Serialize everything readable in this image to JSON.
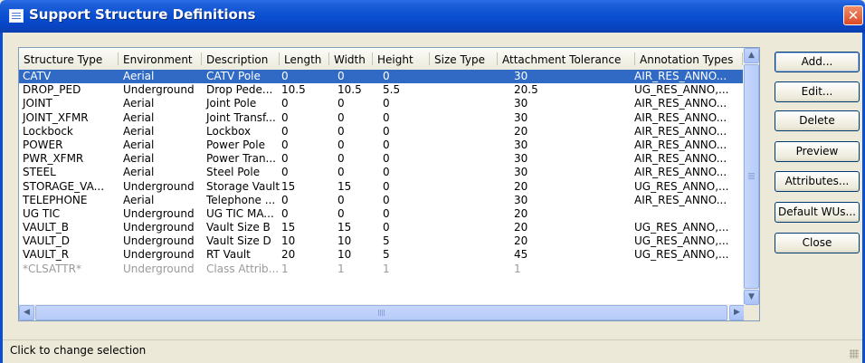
{
  "window": {
    "title": "Support Structure Definitions",
    "close_glyph": "✕",
    "accent": "#0a4fd1",
    "selection_color": "#316ac5"
  },
  "columns": [
    "Structure Type",
    "Environment",
    "Description",
    "Length",
    "Width",
    "Height",
    "Size Type",
    "Attachment Tolerance",
    "Annotation Types"
  ],
  "rows": [
    [
      "CATV",
      "Aerial",
      "CATV Pole",
      "0",
      "0",
      "0",
      "",
      "30",
      "AIR_RES_ANNO..."
    ],
    [
      "DROP_PED",
      "Underground",
      "Drop Pede...",
      "10.5",
      "10.5",
      "5.5",
      "",
      "20.5",
      "UG_RES_ANNO,..."
    ],
    [
      "JOINT",
      "Aerial",
      "Joint Pole",
      "0",
      "0",
      "0",
      "",
      "30",
      "AIR_RES_ANNO..."
    ],
    [
      "JOINT_XFMR",
      "Aerial",
      "Joint Transf...",
      "0",
      "0",
      "0",
      "",
      "30",
      "AIR_RES_ANNO..."
    ],
    [
      "Lockbock",
      "Aerial",
      "Lockbox",
      "0",
      "0",
      "0",
      "",
      "20",
      "AIR_RES_ANNO..."
    ],
    [
      "POWER",
      "Aerial",
      "Power Pole",
      "0",
      "0",
      "0",
      "",
      "30",
      "AIR_RES_ANNO..."
    ],
    [
      "PWR_XFMR",
      "Aerial",
      "Power Tran...",
      "0",
      "0",
      "0",
      "",
      "30",
      "AIR_RES_ANNO..."
    ],
    [
      "STEEL",
      "Aerial",
      "Steel Pole",
      "0",
      "0",
      "0",
      "",
      "30",
      "AIR_RES_ANNO..."
    ],
    [
      "STORAGE_VA...",
      "Underground",
      "Storage Vault",
      "15",
      "15",
      "0",
      "",
      "20",
      "UG_RES_ANNO,..."
    ],
    [
      "TELEPHONE",
      "Aerial",
      "Telephone ...",
      "0",
      "0",
      "0",
      "",
      "30",
      "AIR_RES_ANNO..."
    ],
    [
      "UG TIC",
      "Underground",
      "UG TIC MA...",
      "0",
      "0",
      "0",
      "",
      "20",
      ""
    ],
    [
      "VAULT_B",
      "Underground",
      "Vault Size B",
      "15",
      "15",
      "0",
      "",
      "20",
      "UG_RES_ANNO,..."
    ],
    [
      "VAULT_D",
      "Underground",
      "Vault Size D",
      "10",
      "10",
      "5",
      "",
      "20",
      "UG_RES_ANNO,..."
    ],
    [
      "VAULT_R",
      "Underground",
      "RT Vault",
      "20",
      "10",
      "5",
      "",
      "45",
      "UG_RES_ANNO,..."
    ],
    [
      "*CLSATTR*",
      "Underground",
      "Class Attrib...",
      "1",
      "1",
      "1",
      "",
      "1",
      ""
    ]
  ],
  "selected_row": 0,
  "dimmed_row": 14,
  "buttons": {
    "add": "Add...",
    "edit": "Edit...",
    "delete": "Delete",
    "preview": "Preview",
    "attributes": "Attributes...",
    "default_wus": "Default WUs...",
    "close": "Close"
  },
  "status": "Click to change selection",
  "icons": {
    "window": "table-icon",
    "scroll_up": "▲",
    "scroll_down": "▼",
    "scroll_left": "◀",
    "scroll_right": "▶"
  }
}
